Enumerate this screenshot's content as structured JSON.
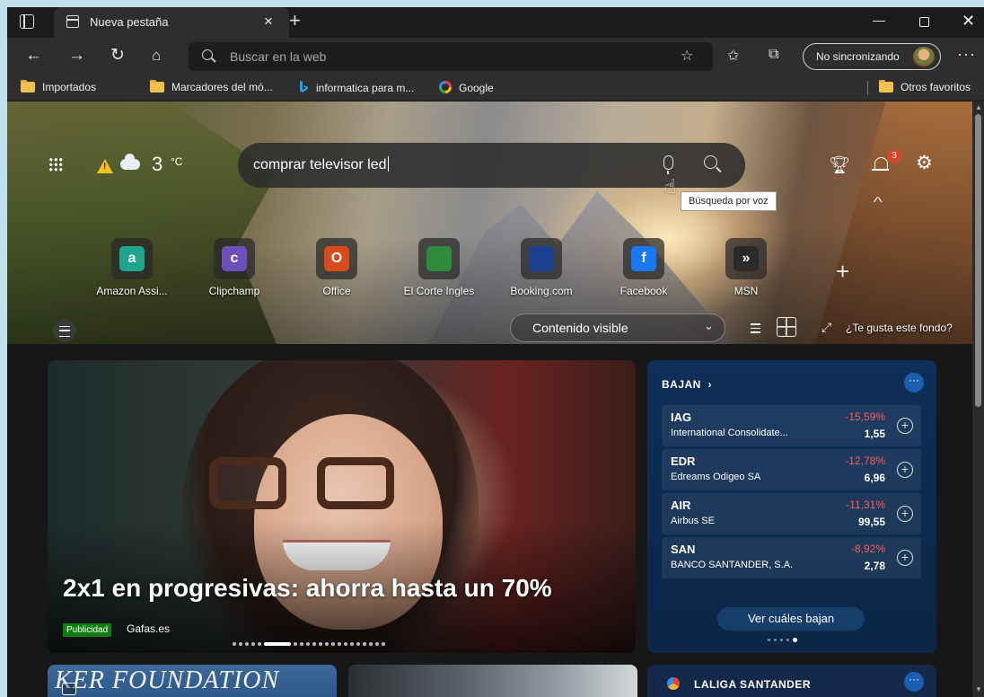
{
  "browser": {
    "tab_title": "Nueva pestaña",
    "address_placeholder": "Buscar en la web",
    "profile_label": "No sincronizando",
    "icons": [
      "tab-actions-icon",
      "new-tab-icon",
      "back-icon",
      "forward-icon",
      "refresh-icon",
      "home-icon",
      "search-icon",
      "add-favorite-icon",
      "favorites-icon",
      "collections-icon",
      "more-icon"
    ]
  },
  "favorites": {
    "items": [
      {
        "label": "Importados",
        "icon": "folder-icon"
      },
      {
        "label": "Marcadores del mó...",
        "icon": "folder-icon"
      },
      {
        "label": "informatica para m...",
        "icon": "bing-icon"
      },
      {
        "label": "Google",
        "icon": "google-icon"
      }
    ],
    "other": "Otros favoritos"
  },
  "newtab": {
    "weather": {
      "temp": "3",
      "unit": "°C"
    },
    "search": {
      "query": "comprar televisor led",
      "voice_tooltip": "Búsqueda por voz"
    },
    "notifications_count": "3",
    "quick_links": [
      {
        "label": "Amazon Assi...",
        "letter": "a",
        "color": "#1fa58c"
      },
      {
        "label": "Clipchamp",
        "letter": "c",
        "color": "#6b4fbb"
      },
      {
        "label": "Office",
        "letter": "O",
        "color": "#d84b1d"
      },
      {
        "label": "El Corte Ingles",
        "letter": "",
        "color": "#2e8b3c"
      },
      {
        "label": "Booking.com",
        "letter": "",
        "color": "#1c3f8f"
      },
      {
        "label": "Facebook",
        "letter": "f",
        "color": "#1877f2"
      },
      {
        "label": "MSN",
        "letter": "»",
        "color": "#2b2b2b"
      }
    ],
    "content_visible": "Contenido visible",
    "like_background": "¿Te gusta este fondo?"
  },
  "feed": {
    "hero": {
      "title": "2x1 en progresivas: ahorra hasta un 70%",
      "badge": "Publicidad",
      "source": "Gafas.es",
      "slide_index": 6,
      "slide_count": 21
    },
    "stocks": {
      "header": "BAJAN",
      "rows": [
        {
          "symbol": "IAG",
          "name": "International Consolidate...",
          "change": "-15,59%",
          "price": "1,55"
        },
        {
          "symbol": "EDR",
          "name": "Edreams Odigeo SA",
          "change": "-12,78%",
          "price": "6,96"
        },
        {
          "symbol": "AIR",
          "name": "Airbus SE",
          "change": "-11,31%",
          "price": "99,55"
        },
        {
          "symbol": "SAN",
          "name": "BANCO SANTANDER, S.A.",
          "change": "-8,92%",
          "price": "2,78"
        }
      ],
      "cta": "Ver cuáles bajan",
      "page_index": 5,
      "page_count": 5
    },
    "bottom": {
      "foundation_text": "KER FOUNDATION",
      "laliga_title": "LALIGA SANTANDER"
    }
  }
}
